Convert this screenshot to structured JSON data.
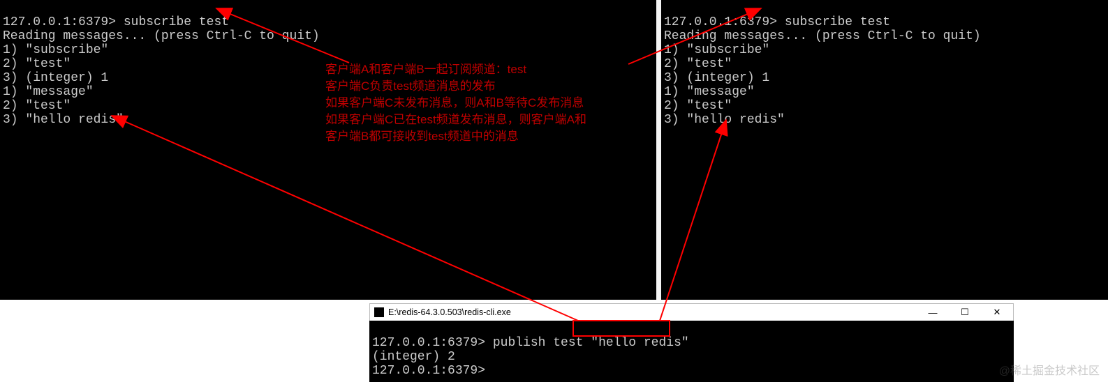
{
  "terminals": {
    "left": {
      "prompt": "127.0.0.1:6379>",
      "command": "subscribe test",
      "lines": [
        "Reading messages... (press Ctrl-C to quit)",
        "1) \"subscribe\"",
        "2) \"test\"",
        "3) (integer) 1",
        "1) \"message\"",
        "2) \"test\"",
        "3) \"hello redis\""
      ]
    },
    "right": {
      "prompt": "127.0.0.1:6379>",
      "command": "subscribe test",
      "lines": [
        "Reading messages... (press Ctrl-C to quit)",
        "1) \"subscribe\"",
        "2) \"test\"",
        "3) (integer) 1",
        "1) \"message\"",
        "2) \"test\"",
        "3) \"hello redis\""
      ]
    },
    "bottom": {
      "title": "E:\\redis-64.3.0.503\\redis-cli.exe",
      "prompt1": "127.0.0.1:6379>",
      "command1": "publish test \"hello redis\"",
      "result": "(integer) 2",
      "prompt2": "127.0.0.1:6379>"
    }
  },
  "annotation": {
    "l1": "客户端A和客户端B一起订阅频道：test",
    "l2": "客户端C负责test频道消息的发布",
    "l3": "如果客户端C未发布消息，则A和B等待C发布消息",
    "l4": "如果客户端C已在test频道发布消息，则客户端A和",
    "l5": "客户端B都可接收到test频道中的消息"
  },
  "window_buttons": {
    "min": "—",
    "max": "☐",
    "close": "✕"
  },
  "watermark": "@稀土掘金技术社区"
}
